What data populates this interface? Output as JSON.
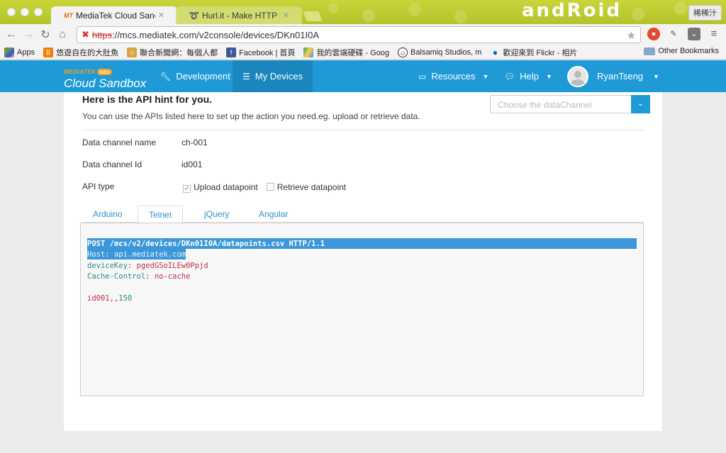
{
  "browser": {
    "tabs": [
      {
        "label": "MediaTek Cloud Sandbox",
        "favicon": "MT",
        "active": true
      },
      {
        "label": "Hurl.it - Make HTTP reque",
        "favicon": "hurl-icon",
        "active": false
      }
    ],
    "android_text": "andRoid",
    "user_chip": "稀稀汁",
    "url_scheme": "https",
    "url_rest": "://mcs.mediatek.com/v2console/devices/DKn01I0A",
    "bookmarks": [
      {
        "label": "Apps",
        "icon": "apps-grid-icon"
      },
      {
        "label": "悠遊自在的大肚魚",
        "icon": "blogger-icon"
      },
      {
        "label": "聯合新聞網：每個人都",
        "icon": "news-icon"
      },
      {
        "label": "Facebook | 首頁",
        "icon": "facebook-icon"
      },
      {
        "label": "我的雲端硬碟 - Goog",
        "icon": "google-drive-icon"
      },
      {
        "label": "Balsamiq Studios, m",
        "icon": "balsamiq-icon"
      },
      {
        "label": "歡迎來到 Flickr - 相片",
        "icon": "flickr-icon"
      }
    ],
    "other_bookmarks": "Other Bookmarks"
  },
  "nav": {
    "brand_top": "MEDIATEK",
    "brand_labs": "labs",
    "brand_name": "Cloud Sandbox",
    "development": "Development",
    "my_devices": "My Devices",
    "resources": "Resources",
    "help": "Help",
    "user": "RyanTseng"
  },
  "content": {
    "hint_title": "Here is the API hint for you.",
    "hint_desc": "You can use the APIs listed here to set up the action you need.eg. upload or retrieve data.",
    "select_placeholder": "Choose the dataChannel",
    "rows": [
      {
        "label": "Data channel name",
        "value": "ch-001"
      },
      {
        "label": "Data channel Id",
        "value": "id001"
      }
    ],
    "api_type_label": "API type",
    "api_upload": "Upload datapoint",
    "api_retrieve": "Retrieve datapoint",
    "code_tabs": [
      "Arduino",
      "Telnet",
      "jQuery",
      "Angular"
    ],
    "code_lines": [
      {
        "key": "POST",
        "value": " /mcs/v2/devices/DKn01I0A/datapoints.csv HTTP/1.1"
      },
      {
        "key": "Host",
        "value": ": api.mediatek.com"
      },
      {
        "key": "deviceKey",
        "value": ": pgedGSoILEw0Ppjd"
      },
      {
        "key": "Cache-Control",
        "value": ": no-cache"
      },
      {
        "key": "",
        "value": ""
      },
      {
        "key": "id001,,",
        "value": "150"
      }
    ]
  }
}
